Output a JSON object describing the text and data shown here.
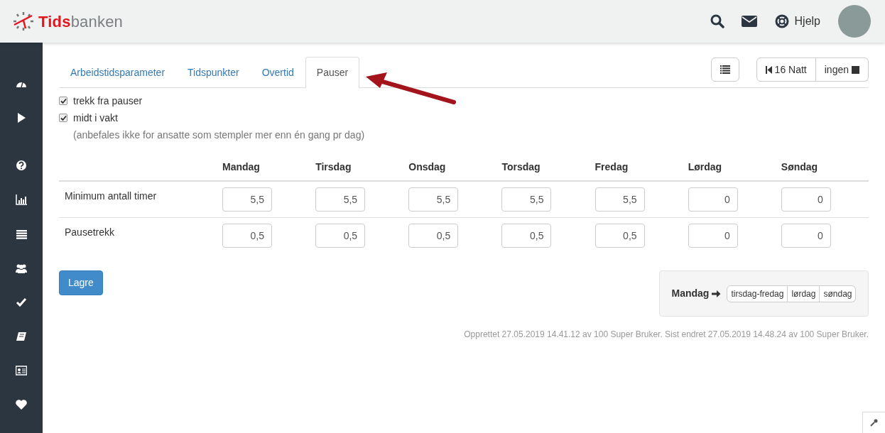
{
  "header": {
    "logo": "**Tids**banken",
    "help_label": "Hjelp"
  },
  "sidebar": {
    "items": [
      {
        "kind": "gauge"
      },
      {
        "kind": "play"
      },
      {
        "kind": "gap"
      },
      {
        "kind": "help"
      },
      {
        "kind": "chart"
      },
      {
        "kind": "list"
      },
      {
        "kind": "users"
      },
      {
        "kind": "check"
      },
      {
        "kind": "book"
      },
      {
        "kind": "card"
      },
      {
        "kind": "heart"
      }
    ]
  },
  "tabs": [
    {
      "label": "Arbeidstidsparameter",
      "selected": false
    },
    {
      "label": "Tidspunkter",
      "selected": false
    },
    {
      "label": "Overtid",
      "selected": false
    },
    {
      "label": "Pauser",
      "selected": true
    }
  ],
  "toolbar": {
    "shift_label": "16 Natt",
    "color_label": "ingen"
  },
  "options": [
    {
      "label": "trekk fra pauser",
      "checked": true
    },
    {
      "label": "midt i vakt",
      "checked": true
    }
  ],
  "note": "(anbefales ikke for ansatte som stempler mer enn én gang pr dag)",
  "table": {
    "columns": [
      "Mandag",
      "Tirsdag",
      "Onsdag",
      "Torsdag",
      "Fredag",
      "Lørdag",
      "Søndag"
    ],
    "rows": [
      {
        "label": "Minimum antall timer",
        "values": [
          "5,5",
          "5,5",
          "5,5",
          "5,5",
          "5,5",
          "0",
          "0"
        ]
      },
      {
        "label": "Pausetrekk",
        "values": [
          "0,5",
          "0,5",
          "0,5",
          "0,5",
          "0,5",
          "0",
          "0"
        ]
      }
    ]
  },
  "save_button": "Lagre",
  "copy_panel": {
    "label": "Mandag",
    "targets": [
      "tirsdag-fredag",
      "lørdag",
      "søndag"
    ]
  },
  "footer_note": "Opprettet 27.05.2019 14.41.12 av 100 Super Bruker. Sist endret 27.05.2019 14.48.24 av 100 Super Bruker."
}
